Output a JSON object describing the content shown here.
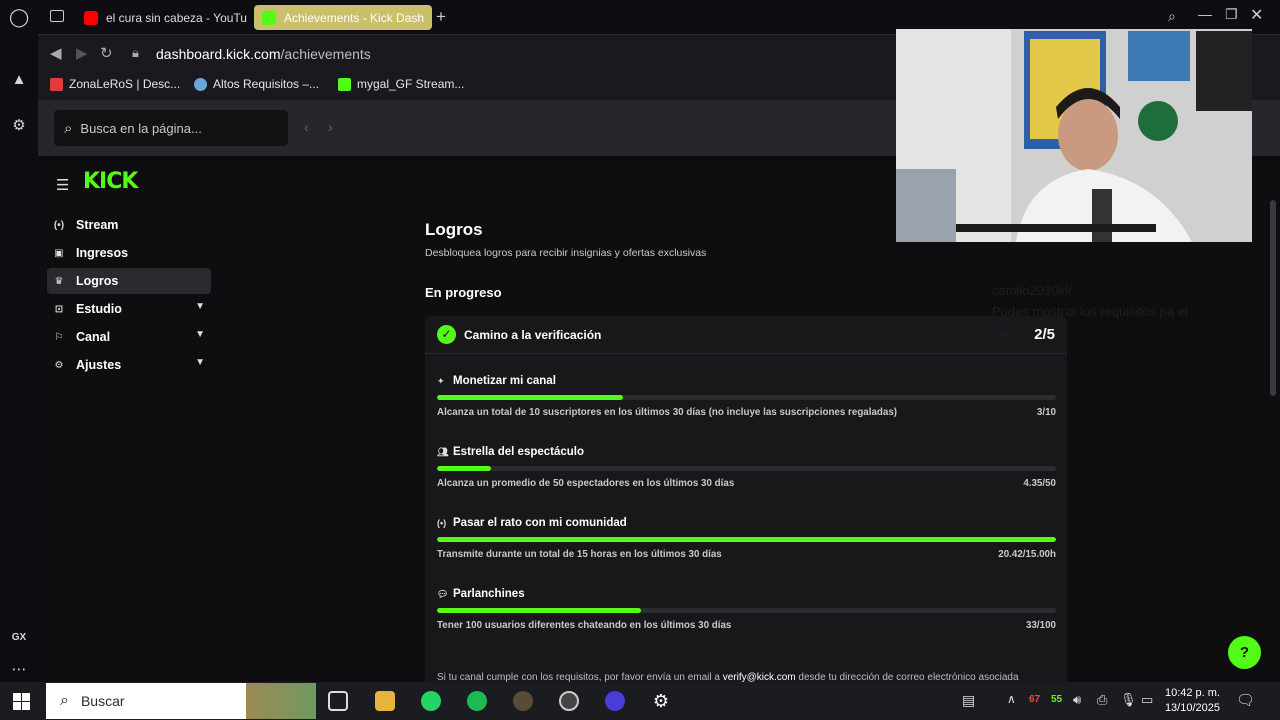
{
  "browser": {
    "tabs": [
      {
        "title": "el cura sin cabeza - YouTu",
        "active": false,
        "favicon": "youtube-icon",
        "color": "#ff0000"
      },
      {
        "title": "Achievements - Kick Dash",
        "active": true,
        "favicon": "kick-icon",
        "color": "#53fc18"
      }
    ],
    "new_tab": "+",
    "url_host": "dashboard.kick.com",
    "url_path": "/achievements",
    "bookmarks": [
      {
        "label": "ZonaLeRoS | Desc...",
        "favicon": "zonaleros-icon"
      },
      {
        "label": "Altos Requisitos –...",
        "favicon": "globe-icon"
      },
      {
        "label": "mygal_GF Stream...",
        "favicon": "kick-icon"
      }
    ],
    "find_placeholder": "Busca en la página...",
    "rail_label": "GX"
  },
  "sidebar": {
    "items": [
      {
        "label": "Stream",
        "icon": "broadcast-icon",
        "expandable": false,
        "active": false
      },
      {
        "label": "Ingresos",
        "icon": "wallet-icon",
        "expandable": false,
        "active": false
      },
      {
        "label": "Logros",
        "icon": "trophy-icon",
        "expandable": false,
        "active": true
      },
      {
        "label": "Estudio",
        "icon": "studio-icon",
        "expandable": true,
        "active": false
      },
      {
        "label": "Canal",
        "icon": "channel-icon",
        "expandable": true,
        "active": false
      },
      {
        "label": "Ajustes",
        "icon": "settings-icon",
        "expandable": true,
        "active": false
      }
    ]
  },
  "main": {
    "title": "Logros",
    "subtitle": "Desbloquea logros para recibir insignias y ofertas exclusivas",
    "section": "En progreso",
    "achievement": {
      "name": "Camino a la verificación",
      "progress": "2/5",
      "requirements": [
        {
          "title": "Monetizar mi canal",
          "icon": "sparkle-icon",
          "description": "Alcanza un total de 10 suscriptores en los últimos 30 días (no incluye las suscripciones regaladas)",
          "value": "3/10",
          "fraction": 0.3
        },
        {
          "title": "Estrella del espectáculo",
          "icon": "users-icon",
          "description": "Alcanza un promedio de 50 espectadores en los últimos 30 días",
          "value": "4.35/50",
          "fraction": 0.087
        },
        {
          "title": "Pasar el rato con mi comunidad",
          "icon": "broadcast-icon",
          "description": "Transmite durante un total de 15 horas en los últimos 30 días",
          "value": "20.42/15.00h",
          "fraction": 1.0
        },
        {
          "title": "Parlanchines",
          "icon": "chat-icon",
          "description": "Tener 100 usuarios diferentes chateando en los últimos 30 días",
          "value": "33/100",
          "fraction": 0.33
        }
      ],
      "footer_pre": "Si tu canal cumple con los requisitos, por favor envía un email a ",
      "footer_email": "verify@kick.com",
      "footer_post": " desde tu dirección de correo electrónico asociada"
    }
  },
  "chat_ghost": {
    "user": "camilo2030kk",
    "message": "Podes mostrar los requisitos pa el parce"
  },
  "taskbar": {
    "search_placeholder": "Buscar",
    "time": "10:42 p. m.",
    "date": "13/10/2025",
    "tray_red": "67",
    "tray_green": "55"
  }
}
